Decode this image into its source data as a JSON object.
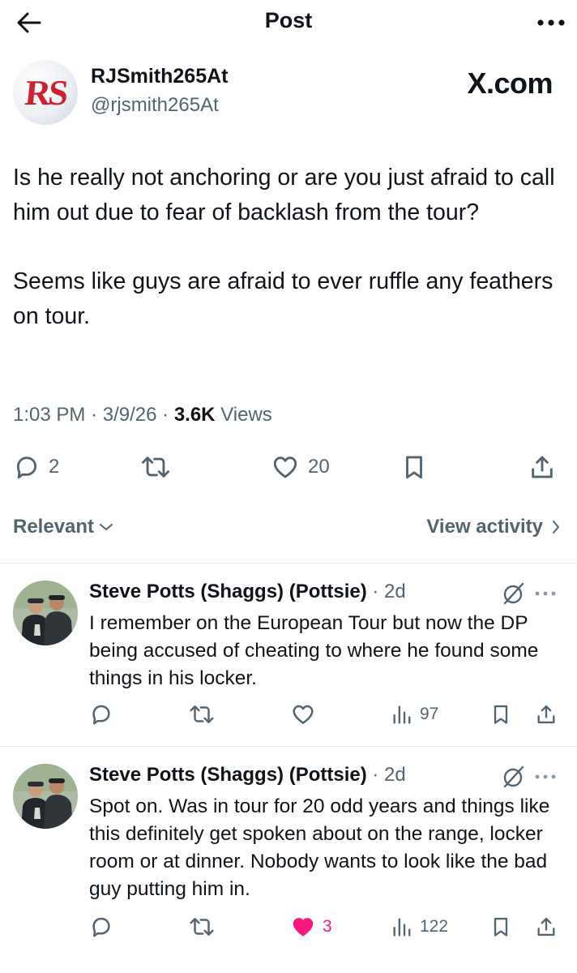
{
  "header": {
    "title": "Post"
  },
  "post": {
    "author_name": "RJSmith265At",
    "author_handle": "@rjsmith265At",
    "avatar_text": "RS",
    "watermark": "X.com",
    "paragraphs": [
      "Is he really not anchoring or are you just afraid to call him out due to fear of backlash from the tour?",
      "Seems like guys are afraid to ever ruffle any feathers on tour."
    ],
    "time": "1:03 PM",
    "date": "3/9/26",
    "views_count": "3.6K",
    "views_label": "Views",
    "replies": "2",
    "likes": "20"
  },
  "sort": {
    "relevant_label": "Relevant",
    "view_activity_label": "View activity"
  },
  "replies": [
    {
      "name": "Steve Potts (Shaggs) (Pottsie)",
      "age": "2d",
      "text": "I remember on the European Tour but now the DP being accused of cheating to where he found some things in his locker.",
      "likes": "",
      "liked": false,
      "views": "97"
    },
    {
      "name": "Steve Potts (Shaggs) (Pottsie)",
      "age": "2d",
      "text": "Spot on. Was in tour for 20 odd years and things like this definitely get spoken about on the range, locker room or at dinner. Nobody wants to look like the bad guy putting him in.",
      "likes": "3",
      "liked": true,
      "views": "122"
    }
  ],
  "colors": {
    "text": "#0f1419",
    "secondary": "#536471",
    "like": "#f91880",
    "divider": "#e6e9ec"
  }
}
